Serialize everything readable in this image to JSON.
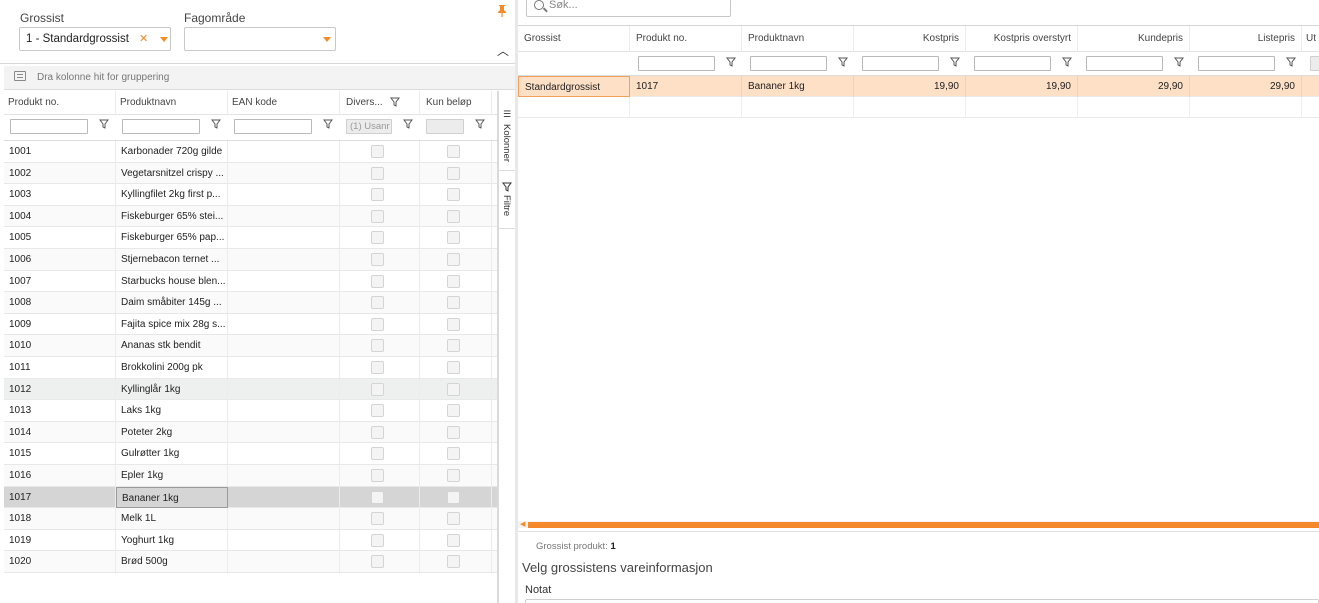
{
  "filters": {
    "grossist_label": "Grossist",
    "grossist_value": "1 - Standardgrossist",
    "fagomrade_label": "Fagområde",
    "fagomrade_value": ""
  },
  "group_bar": {
    "text": "Dra kolonne hit for gruppering"
  },
  "left_grid": {
    "columns": [
      "Produkt no.",
      "Produktnavn",
      "EAN kode",
      "Divers...",
      "Kun beløp"
    ],
    "divers_filter_value": "(1) Usanr",
    "rows": [
      {
        "no": "1001",
        "name": "Karbonader 720g gilde"
      },
      {
        "no": "1002",
        "name": "Vegetarsnitzel crispy ..."
      },
      {
        "no": "1003",
        "name": "Kyllingfilet 2kg first p..."
      },
      {
        "no": "1004",
        "name": "Fiskeburger 65% stei..."
      },
      {
        "no": "1005",
        "name": "Fiskeburger 65% pap..."
      },
      {
        "no": "1006",
        "name": "Stjernebacon ternet ..."
      },
      {
        "no": "1007",
        "name": "Starbucks house blen..."
      },
      {
        "no": "1008",
        "name": "Daim småbiter 145g ..."
      },
      {
        "no": "1009",
        "name": "Fajita spice mix 28g s..."
      },
      {
        "no": "1010",
        "name": "Ananas stk bendit"
      },
      {
        "no": "1011",
        "name": "Brokkolini 200g pk"
      },
      {
        "no": "1012",
        "name": "Kyllinglår 1kg"
      },
      {
        "no": "1013",
        "name": "Laks 1kg"
      },
      {
        "no": "1014",
        "name": "Poteter 2kg"
      },
      {
        "no": "1015",
        "name": "Gulrøtter 1kg"
      },
      {
        "no": "1016",
        "name": "Epler 1kg"
      },
      {
        "no": "1017",
        "name": "Bananer 1kg"
      },
      {
        "no": "1018",
        "name": "Melk 1L"
      },
      {
        "no": "1019",
        "name": "Yoghurt 1kg"
      },
      {
        "no": "1020",
        "name": "Brød 500g"
      }
    ],
    "selected_row": "1017",
    "hover_row": "1012"
  },
  "side_panel": {
    "columns_tab": "Kolonner",
    "filter_tab": "Filtre"
  },
  "search": {
    "placeholder": "Søk..."
  },
  "right_grid": {
    "columns": [
      "Grossist",
      "Produkt no.",
      "Produktnavn",
      "Kostpris",
      "Kostpris overstyrt",
      "Kundepris",
      "Listepris",
      "Ut"
    ],
    "rows": [
      {
        "grossist": "Standardgrossist",
        "no": "1017",
        "name": "Bananer 1kg",
        "kostpris": "19,90",
        "kostpris_overstyrt": "19,90",
        "kundepris": "29,90",
        "listepris": "29,90"
      }
    ]
  },
  "status": {
    "label": "Grossist produkt:",
    "value": "1"
  },
  "section": {
    "title": "Velg grossistens vareinformasjon",
    "notat_label": "Notat"
  },
  "colors": {
    "accent": "#f5882a",
    "selected_row_right": "#fde0c6",
    "selected_row_left": "#d5d5d5"
  }
}
